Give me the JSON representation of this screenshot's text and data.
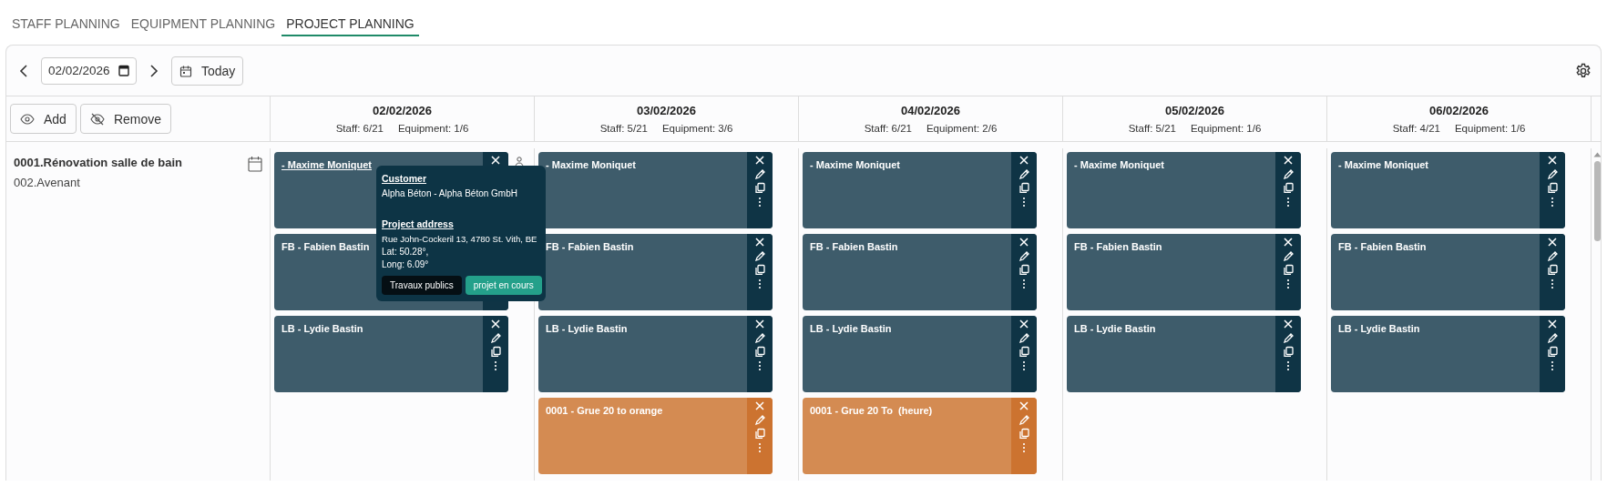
{
  "tabs": [
    {
      "label": "STAFF PLANNING",
      "selected": false
    },
    {
      "label": "EQUIPMENT PLANNING",
      "selected": false
    },
    {
      "label": "PROJECT PLANNING",
      "selected": true
    }
  ],
  "toolbar": {
    "date": "02/02/2026",
    "today": "Today"
  },
  "row_actions": [
    {
      "label": "Add",
      "kind": "add"
    },
    {
      "label": "Remove",
      "kind": "remove"
    }
  ],
  "project": {
    "title": "0001.Rénovation salle de bain",
    "subtitle": "002.Avenant"
  },
  "days": [
    {
      "date": "02/02/2026",
      "staff": "Staff: 6/21",
      "equipment": "Equipment: 1/6",
      "cards": [
        {
          "label": "- Maxime Moniquet",
          "kind": "staff",
          "hovered": true
        },
        {
          "label": "FB - Fabien Bastin",
          "kind": "staff",
          "hovered": false
        },
        {
          "label": "LB - Lydie Bastin",
          "kind": "staff",
          "hovered": false
        }
      ]
    },
    {
      "date": "03/02/2026",
      "staff": "Staff: 5/21",
      "equipment": "Equipment: 3/6",
      "cards": [
        {
          "label": "- Maxime Moniquet",
          "kind": "staff",
          "hovered": false
        },
        {
          "label": "FB - Fabien Bastin",
          "kind": "staff",
          "hovered": false
        },
        {
          "label": "LB - Lydie Bastin",
          "kind": "staff",
          "hovered": false
        },
        {
          "label": "0001 - Grue 20 to orange",
          "kind": "equipment",
          "hovered": false
        }
      ]
    },
    {
      "date": "04/02/2026",
      "staff": "Staff: 6/21",
      "equipment": "Equipment: 2/6",
      "cards": [
        {
          "label": "- Maxime Moniquet",
          "kind": "staff",
          "hovered": false
        },
        {
          "label": "FB - Fabien Bastin",
          "kind": "staff",
          "hovered": false
        },
        {
          "label": "LB - Lydie Bastin",
          "kind": "staff",
          "hovered": false
        },
        {
          "label": "0001 - Grue 20 To  (heure)",
          "kind": "equipment",
          "hovered": false
        }
      ]
    },
    {
      "date": "05/02/2026",
      "staff": "Staff: 5/21",
      "equipment": "Equipment: 1/6",
      "cards": [
        {
          "label": "- Maxime Moniquet",
          "kind": "staff",
          "hovered": false
        },
        {
          "label": "FB - Fabien Bastin",
          "kind": "staff",
          "hovered": false
        },
        {
          "label": "LB - Lydie Bastin",
          "kind": "staff",
          "hovered": false
        }
      ]
    },
    {
      "date": "06/02/2026",
      "staff": "Staff: 4/21",
      "equipment": "Equipment: 1/6",
      "cards": [
        {
          "label": "- Maxime Moniquet",
          "kind": "staff",
          "hovered": false
        },
        {
          "label": "FB - Fabien Bastin",
          "kind": "staff",
          "hovered": false
        },
        {
          "label": "LB - Lydie Bastin",
          "kind": "staff",
          "hovered": false
        }
      ]
    }
  ],
  "tooltip": {
    "customer_heading": "Customer",
    "customer": "Alpha Béton - Alpha Béton GmbH",
    "address_heading": "Project address",
    "address": "Rue John-Cockeril 13, 4780 St. Vith, BE",
    "lat": "Lat: 50.28°,",
    "long": "Long: 6.09°",
    "tags": [
      {
        "label": "Travaux publics",
        "color": "#050f14"
      },
      {
        "label": "projet en cours",
        "color": "#24a08a"
      }
    ]
  }
}
